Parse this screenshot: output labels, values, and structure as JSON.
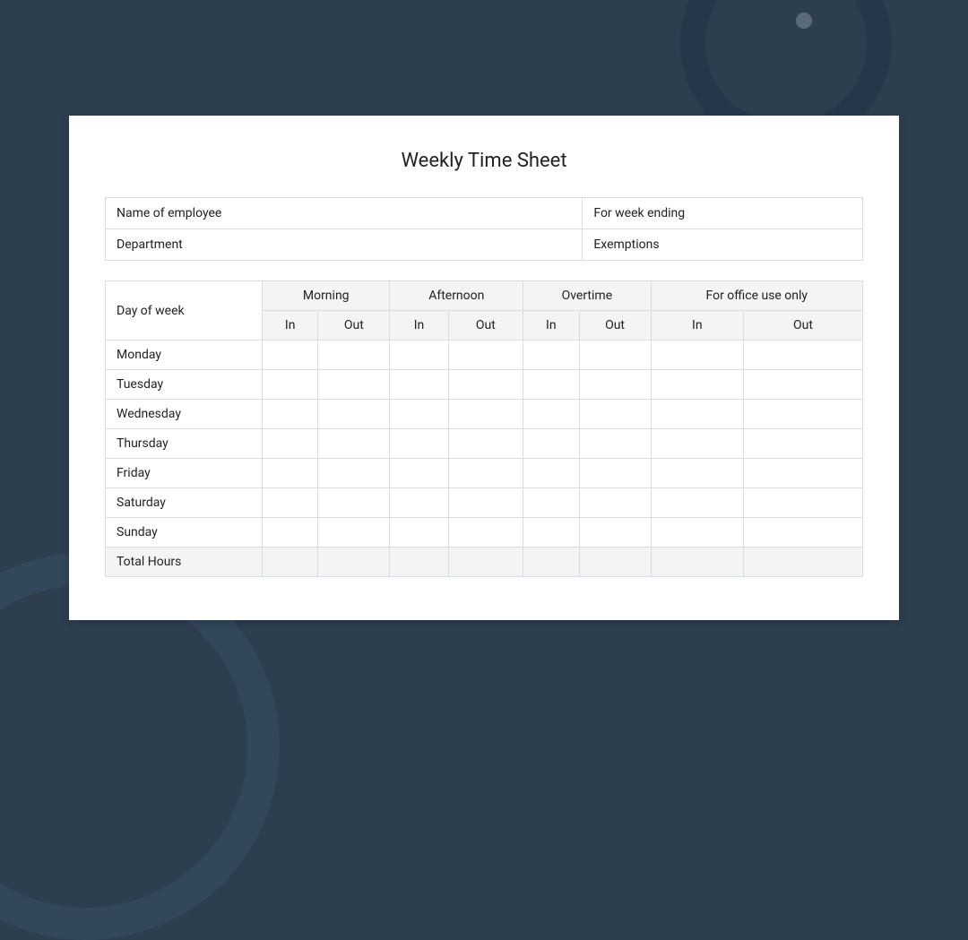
{
  "title": "Weekly Time Sheet",
  "info": {
    "name_label": "Name of employee",
    "week_label": "For week ending",
    "dept_label": "Department",
    "exempt_label": "Exemptions"
  },
  "headers": {
    "day": "Day of week",
    "groups": [
      "Morning",
      "Afternoon",
      "Overtime",
      "For office use only"
    ],
    "sub": {
      "in": "In",
      "out": "Out"
    }
  },
  "days": [
    "Monday",
    "Tuesday",
    "Wednesday",
    "Thursday",
    "Friday",
    "Saturday",
    "Sunday"
  ],
  "total_label": "Total Hours"
}
